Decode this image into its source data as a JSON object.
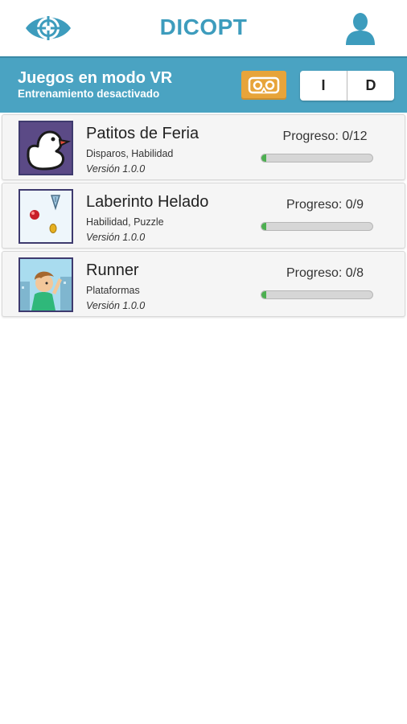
{
  "app": {
    "title": "DICOPT"
  },
  "header": {
    "title": "Juegos en modo VR",
    "subtitle": "Entrenamiento desactivado",
    "eye_options": [
      "I",
      "D"
    ]
  },
  "games": [
    {
      "name": "Patitos de Feria",
      "tags": "Disparos, Habilidad",
      "version": "Versión 1.0.0",
      "progress_text": "Progreso: 0/12",
      "progress_done": 0,
      "progress_total": 12,
      "icon": "duck-icon"
    },
    {
      "name": "Laberinto Helado",
      "tags": "Habilidad, Puzzle",
      "version": "Versión 1.0.0",
      "progress_text": "Progreso: 0/9",
      "progress_done": 0,
      "progress_total": 9,
      "icon": "maze-icon"
    },
    {
      "name": "Runner",
      "tags": "Plataformas",
      "version": "Versión 1.0.0",
      "progress_text": "Progreso: 0/8",
      "progress_done": 0,
      "progress_total": 8,
      "icon": "runner-icon"
    }
  ],
  "colors": {
    "brand": "#3d9cbd",
    "header_bg": "#4aa3c2",
    "vr_button": "#e7a43a",
    "progress": "#4caf50"
  }
}
